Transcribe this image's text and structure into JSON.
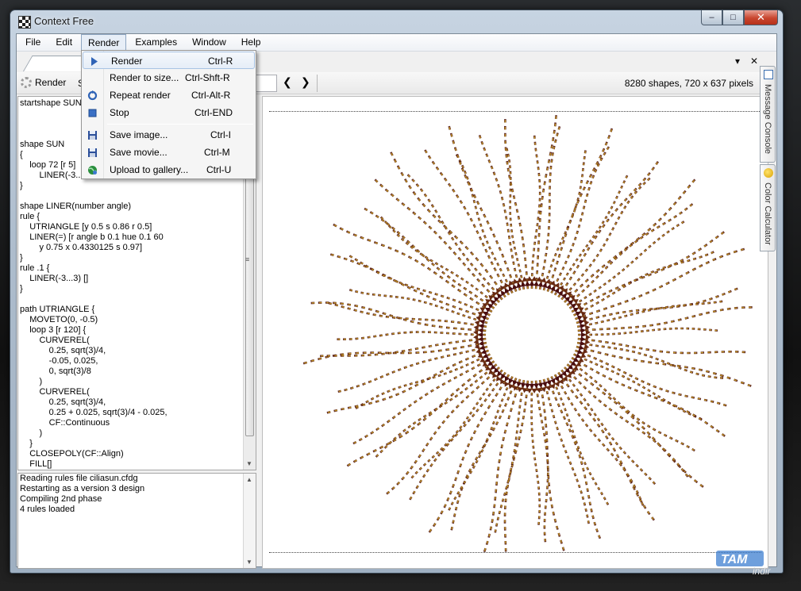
{
  "window": {
    "title": "Context Free"
  },
  "caption_buttons": {
    "minimize": "‒",
    "maximize": "□",
    "close": "✕"
  },
  "menu": [
    "File",
    "Edit",
    "Render",
    "Examples",
    "Window",
    "Help"
  ],
  "tabstrip": {
    "dropdown_glyph": "▾",
    "close_glyph": "✕"
  },
  "toolbar": {
    "render_label": "Render",
    "s_label": "S",
    "prev_glyph": "❮",
    "next_glyph": "❯",
    "status": "8280 shapes, 720 x 637 pixels"
  },
  "editor": {
    "code": [
      "startshape SUN",
      "",
      "",
      "",
      "shape SUN",
      "{",
      "    loop 72 [r 5]",
      "        LINER(-3...",
      "}",
      "",
      "shape LINER(number angle)",
      "rule {",
      "    UTRIANGLE [y 0.5 s 0.86 r 0.5]",
      "    LINER(=) [r angle b 0.1 hue 0.1 60",
      "        y 0.75 x 0.4330125 s 0.97]",
      "}",
      "rule .1 {",
      "    LINER(-3...3) []",
      "}",
      "",
      "path UTRIANGLE {",
      "    MOVETO(0, -0.5)",
      "    loop 3 [r 120] {",
      "        CURVEREL(",
      "            0.25, sqrt(3)/4,",
      "            -0.05, 0.025,",
      "            0, sqrt(3)/8",
      "        )",
      "        CURVEREL(",
      "            0.25, sqrt(3)/4,",
      "            0.25 + 0.025, sqrt(3)/4 - 0.025,",
      "            CF::Continuous",
      "        )",
      "    }",
      "    CLOSEPOLY(CF::Align)",
      "    FILL[]"
    ]
  },
  "console": {
    "lines": [
      "Reading rules file ciliasun.cfdg",
      "Restarting as a version 3 design",
      "Compiling 2nd phase",
      "4 rules loaded"
    ]
  },
  "render_menu": {
    "items": [
      {
        "label": "Render",
        "shortcut": "Ctrl-R",
        "icon": "play-icon"
      },
      {
        "label": "Render to size...",
        "shortcut": "Ctrl-Shft-R",
        "icon": ""
      },
      {
        "label": "Repeat render",
        "shortcut": "Ctrl-Alt-R",
        "icon": "refresh-icon"
      },
      {
        "label": "Stop",
        "shortcut": "Ctrl-END",
        "icon": "stop-icon"
      },
      {
        "label": "Save image...",
        "shortcut": "Ctrl-I",
        "icon": "floppy-icon"
      },
      {
        "label": "Save movie...",
        "shortcut": "Ctrl-M",
        "icon": "floppy-icon"
      },
      {
        "label": "Upload to gallery...",
        "shortcut": "Ctrl-U",
        "icon": "globe-icon"
      }
    ]
  },
  "side_tabs": [
    "Message Console",
    "Color Calculator"
  ],
  "watermark": {
    "text": "TAM",
    "subtext": "indir"
  },
  "colors": {
    "inner": "#4a0d0d",
    "mid": "#a0601a",
    "outer": "#f4df2a",
    "menu_highlight": "#a8c3e4"
  }
}
